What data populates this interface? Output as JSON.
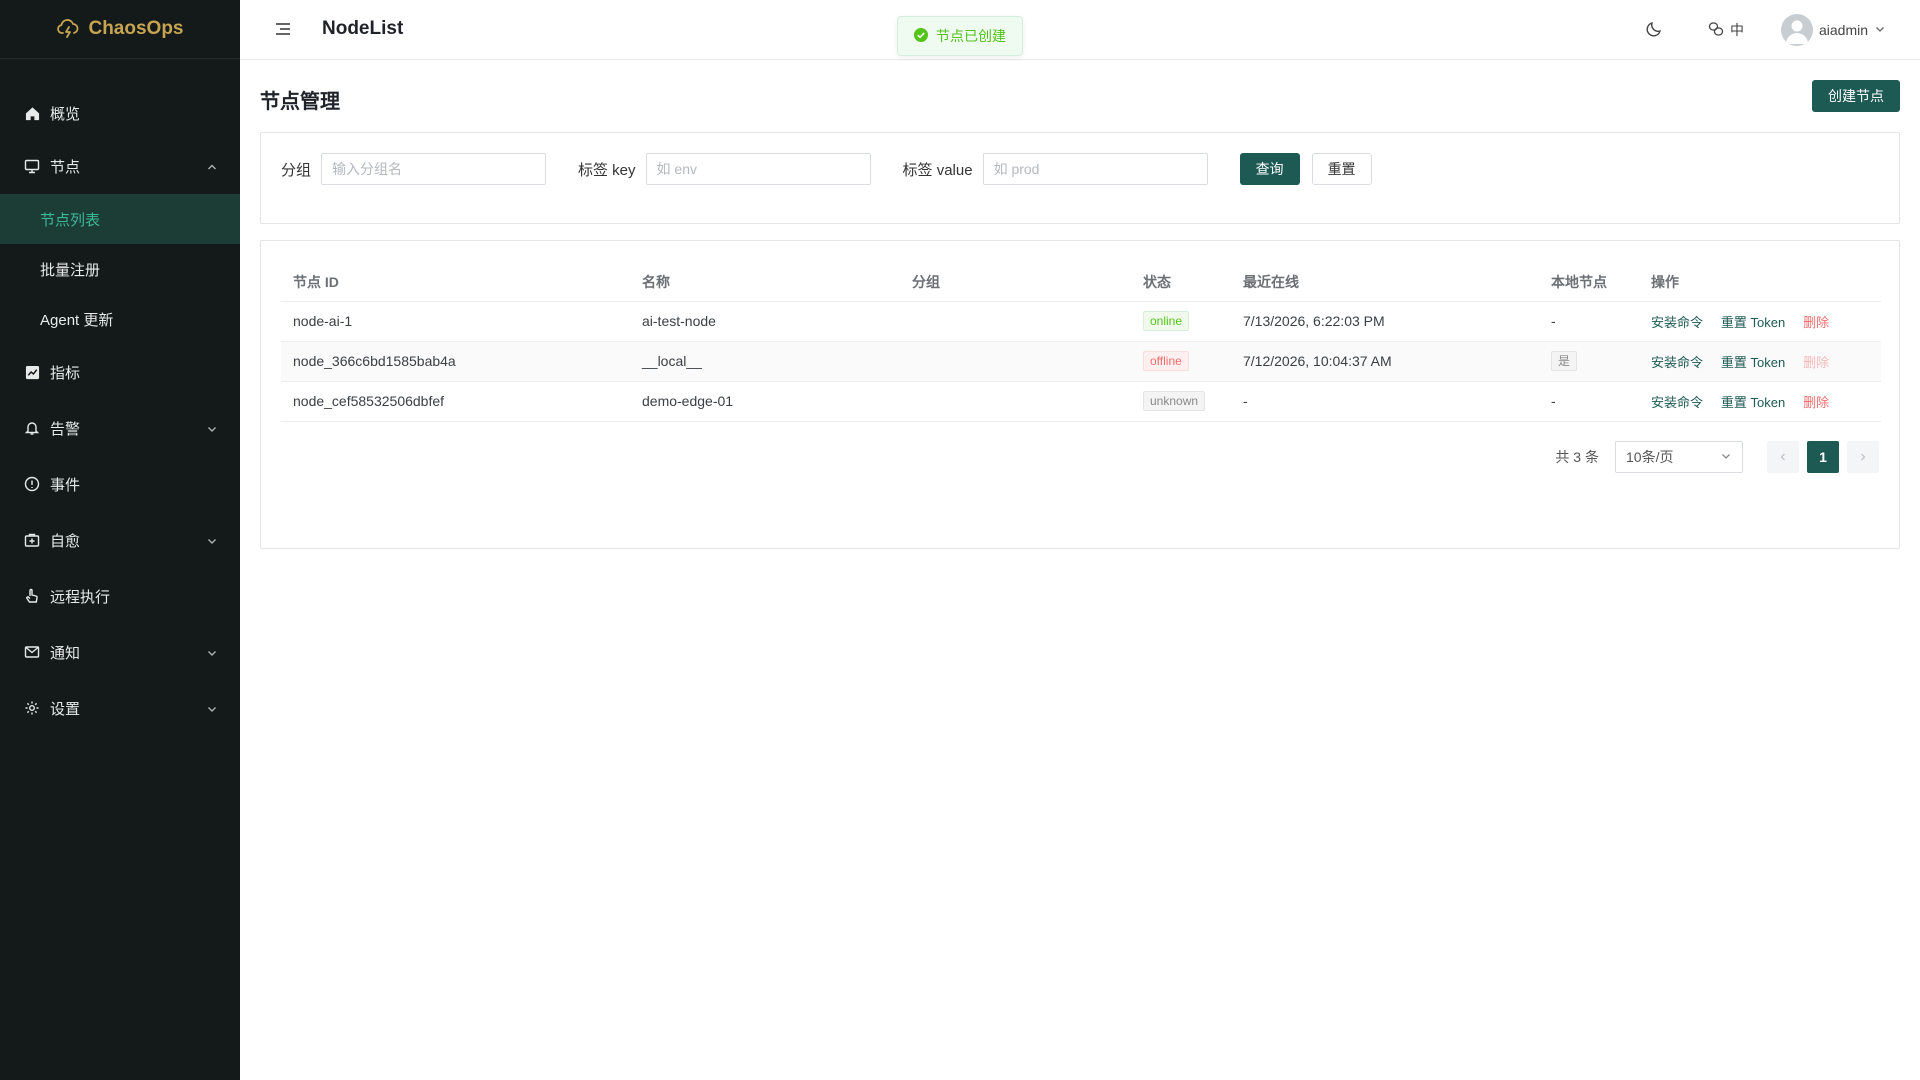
{
  "sidebar": {
    "brand": "ChaosOps",
    "items": [
      {
        "label": "概览"
      },
      {
        "label": "节点"
      },
      {
        "label": "指标"
      },
      {
        "label": "告警"
      },
      {
        "label": "事件"
      },
      {
        "label": "自愈"
      },
      {
        "label": "远程执行"
      },
      {
        "label": "通知"
      },
      {
        "label": "设置"
      }
    ],
    "node_children": [
      {
        "label": "节点列表"
      },
      {
        "label": "批量注册"
      },
      {
        "label": "Agent 更新"
      }
    ]
  },
  "header": {
    "page_name": "NodeList",
    "toast": "节点已创建",
    "lang": "中",
    "user": "aiadmin"
  },
  "main": {
    "title": "节点管理",
    "create_button": "创建节点"
  },
  "filter": {
    "group_label": "分组",
    "group_placeholder": "输入分组名",
    "key_label": "标签 key",
    "key_placeholder": "如 env",
    "value_label": "标签 value",
    "value_placeholder": "如 prod",
    "query_button": "查询",
    "reset_button": "重置"
  },
  "table": {
    "headers": [
      "节点 ID",
      "名称",
      "分组",
      "状态",
      "最近在线",
      "本地节点",
      "操作"
    ],
    "rows": [
      {
        "id": "node-ai-1",
        "name": "ai-test-node",
        "group": "",
        "status": "online",
        "last_seen": "7/13/2026, 6:22:03 PM",
        "local": "-",
        "op_install": "安装命令",
        "op_reset": "重置 Token",
        "op_delete": "删除"
      },
      {
        "id": "node_366c6bd1585bab4a",
        "name": "__local__",
        "group": "",
        "status": "offline",
        "last_seen": "7/12/2026, 10:04:37 AM",
        "local": "是",
        "op_install": "安装命令",
        "op_reset": "重置 Token",
        "op_delete": "删除"
      },
      {
        "id": "node_cef58532506dbfef",
        "name": "demo-edge-01",
        "group": "",
        "status": "unknown",
        "last_seen": "-",
        "local": "-",
        "op_install": "安装命令",
        "op_reset": "重置 Token",
        "op_delete": "删除"
      }
    ]
  },
  "pagination": {
    "total": "共 3 条",
    "page_size": "10条/页",
    "current_page": "1"
  },
  "colors": {
    "accent": "#1d5a54",
    "sidebar_bg": "#141a19",
    "brand": "#c7a451",
    "active_menu_text": "#3db79a",
    "online": "#52c41a",
    "offline": "#f56c6c"
  }
}
